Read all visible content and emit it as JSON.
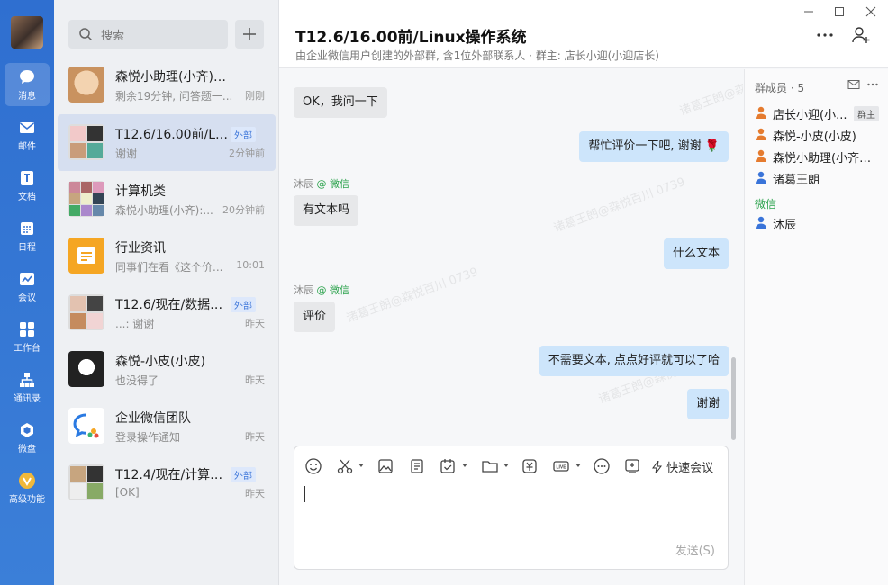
{
  "nav": {
    "items": [
      {
        "label": "消息"
      },
      {
        "label": "邮件"
      },
      {
        "label": "文档"
      },
      {
        "label": "日程"
      },
      {
        "label": "会议"
      },
      {
        "label": "工作台"
      },
      {
        "label": "通讯录"
      },
      {
        "label": "微盘"
      },
      {
        "label": "高级功能"
      }
    ]
  },
  "search": {
    "placeholder": "搜索"
  },
  "conversations": [
    {
      "name": "森悦小助理(小齐)(小齐)",
      "preview": "剩余19分钟, 问答题一...",
      "time": "刚刚",
      "badge": ""
    },
    {
      "name": "T12.6/16.00前/Lin...",
      "preview": "谢谢",
      "time": "2分钟前",
      "badge": "外部"
    },
    {
      "name": "计算机类",
      "preview": "森悦小助理(小齐):...",
      "time": "20分钟前",
      "badge": ""
    },
    {
      "name": "行业资讯",
      "preview": "同事们在看《这个价...",
      "time": "10:01",
      "badge": ""
    },
    {
      "name": "T12.6/现在/数据库...",
      "preview": "...: 谢谢",
      "time": "昨天",
      "badge": "外部"
    },
    {
      "name": "森悦-小皮(小皮)",
      "preview": "也没得了",
      "time": "昨天",
      "badge": ""
    },
    {
      "name": "企业微信团队",
      "preview": "登录操作通知",
      "time": "昨天",
      "badge": ""
    },
    {
      "name": "T12.4/现在/计算机...",
      "preview": "[OK]",
      "time": "昨天",
      "badge": "外部"
    }
  ],
  "chat": {
    "title": "T12.6/16.00前/Linux操作系统",
    "subtitle": "由企业微信用户创建的外部群, 含1位外部联系人 · 群主: 店长小迎(小迎店长)",
    "sender_wechat_tag": "@ 微信",
    "messages": [
      {
        "dir": "in",
        "sender": "沐辰",
        "text": "OK，我问一下"
      },
      {
        "dir": "out",
        "sender": "",
        "text": "帮忙评价一下吧, 谢谢 🌹"
      },
      {
        "dir": "in",
        "sender": "沐辰",
        "text": "有文本吗"
      },
      {
        "dir": "out",
        "sender": "",
        "text": "什么文本"
      },
      {
        "dir": "in",
        "sender": "沐辰",
        "text": "评价"
      },
      {
        "dir": "out",
        "sender": "",
        "text": "不需要文本, 点点好评就可以了哈"
      },
      {
        "dir": "out",
        "sender": "",
        "text": "谢谢"
      }
    ],
    "watermark": "诸葛王朗@森悦百川 0739"
  },
  "composer": {
    "quick_meeting_label": "快速会议",
    "send_label": "发送(S)",
    "tools": [
      "emoji-icon",
      "scissors-icon",
      "image-icon",
      "doc-icon",
      "todo-icon",
      "folder-icon",
      "red-packet-icon",
      "live-icon",
      "more-circle-icon",
      "screen-share-icon"
    ]
  },
  "members": {
    "title": "群成员 · 5",
    "list": [
      {
        "name": "店长小迎(小...",
        "owner_tag": "群主",
        "color": "#e57b2f"
      },
      {
        "name": "森悦-小皮(小皮)",
        "owner_tag": "",
        "color": "#e57b2f"
      },
      {
        "name": "森悦小助理(小齐)(...",
        "owner_tag": "",
        "color": "#e57b2f"
      },
      {
        "name": "诸葛王朗",
        "owner_tag": "",
        "color": "#3a74d9"
      }
    ],
    "wechat_section": "微信",
    "wechat_list": [
      {
        "name": "沐辰",
        "color": "#3a74d9"
      }
    ]
  }
}
